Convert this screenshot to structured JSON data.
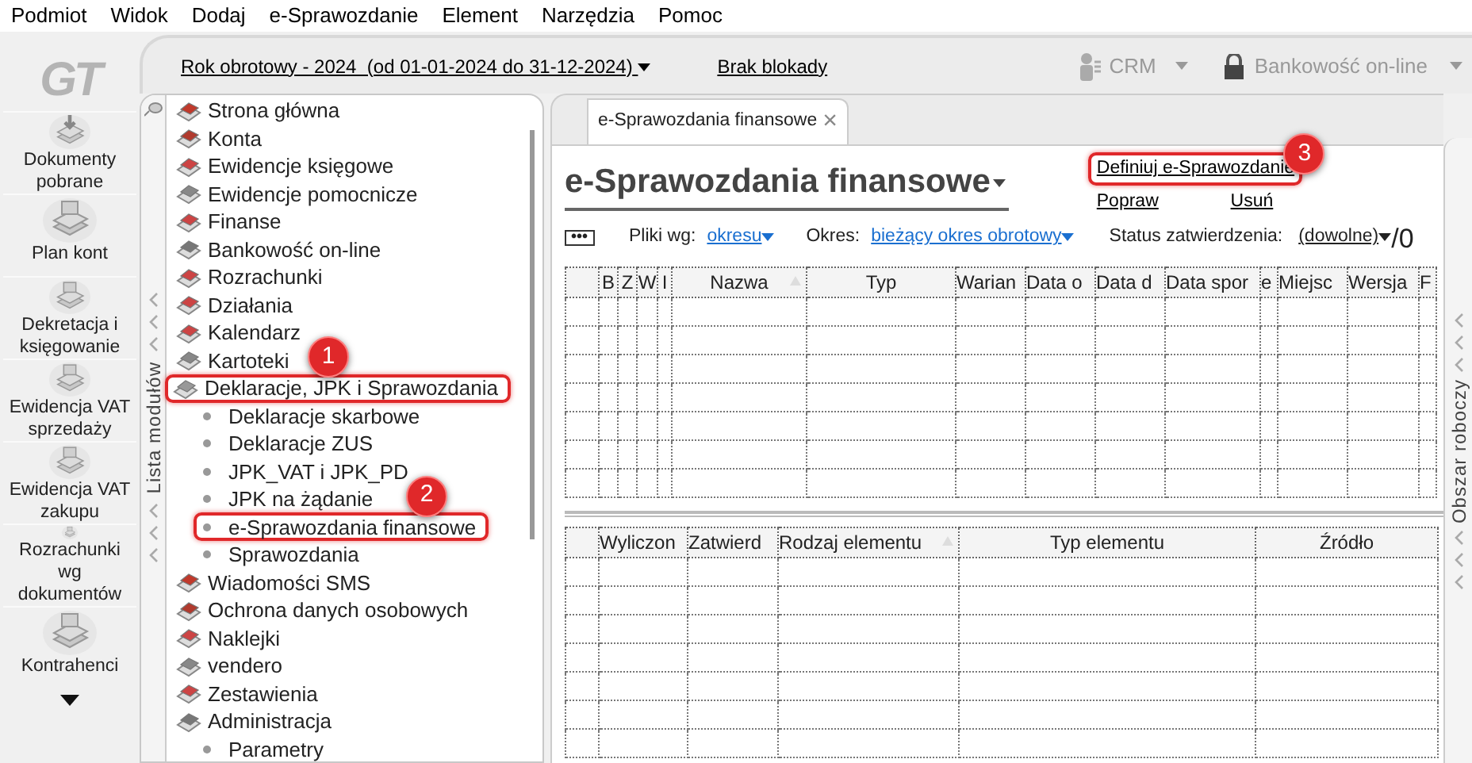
{
  "menu": [
    "Podmiot",
    "Widok",
    "Dodaj",
    "e-Sprawozdanie",
    "Element",
    "Narzędzia",
    "Pomoc"
  ],
  "logo": "GT",
  "toolbar": {
    "period": "Rok obrotowy - 2024  (od 01-01-2024 do 31-12-2024)",
    "lock": "Brak blokady",
    "crm": "CRM",
    "bank": "Bankowość on-line"
  },
  "nav": [
    {
      "label": "Dokumenty pobrane"
    },
    {
      "label": "Plan kont"
    },
    {
      "label": "Dekretacja i księgowanie"
    },
    {
      "label": "Ewidencja VAT sprzedaży"
    },
    {
      "label": "Ewidencja VAT zakupu"
    },
    {
      "label": "Rozrachunki wg dokumentów"
    },
    {
      "label": "Kontrahenci"
    }
  ],
  "modules": {
    "title": "Lista modułów",
    "items": [
      {
        "label": "Strona główna",
        "highlighted": false
      },
      {
        "label": "Konta",
        "highlighted": false
      },
      {
        "label": "Ewidencje księgowe",
        "highlighted": false
      },
      {
        "label": "Ewidencje pomocnicze",
        "highlighted": false
      },
      {
        "label": "Finanse",
        "highlighted": false
      },
      {
        "label": "Bankowość on-line",
        "highlighted": false
      },
      {
        "label": "Rozrachunki",
        "highlighted": false
      },
      {
        "label": "Działania",
        "highlighted": false
      },
      {
        "label": "Kalendarz",
        "highlighted": false
      },
      {
        "label": "Kartoteki",
        "highlighted": false
      },
      {
        "label": "Deklaracje, JPK i Sprawozdania",
        "highlighted": true,
        "callout": "1",
        "children": [
          {
            "label": "Deklaracje skarbowe",
            "highlighted": false
          },
          {
            "label": "Deklaracje ZUS",
            "highlighted": false
          },
          {
            "label": "JPK_VAT i JPK_PD",
            "highlighted": false
          },
          {
            "label": "JPK na żądanie",
            "highlighted": false
          },
          {
            "label": "e-Sprawozdania finansowe",
            "highlighted": true,
            "callout": "2"
          },
          {
            "label": "Sprawozdania",
            "highlighted": false
          }
        ]
      },
      {
        "label": "Wiadomości SMS",
        "highlighted": false
      },
      {
        "label": "Ochrona danych osobowych",
        "highlighted": false
      },
      {
        "label": "Naklejki",
        "highlighted": false
      },
      {
        "label": "vendero",
        "highlighted": false
      },
      {
        "label": "Zestawienia",
        "highlighted": false
      },
      {
        "label": "Administracja",
        "highlighted": false,
        "children": [
          {
            "label": "Parametry",
            "highlighted": false
          }
        ]
      }
    ]
  },
  "tab": {
    "label": "e-Sprawozdania finansowe",
    "close": "×"
  },
  "title": "e-Sprawozdania finansowe",
  "actions": [
    {
      "label": "Definiuj e-Sprawozdanie",
      "highlighted": true,
      "callout": "3"
    },
    {
      "label": "Popraw",
      "highlighted": false
    },
    {
      "label": "Usuń",
      "highlighted": false
    }
  ],
  "filters": {
    "more": "•••",
    "files_label": "Pliki wg:",
    "files_value": "okresu",
    "period_label": "Okres:",
    "period_value": "bieżący okres obrotowy",
    "status_label": "Status zatwierdzenia:",
    "status_value": "(dowolne)",
    "count": "/0"
  },
  "top_table": {
    "columns": [
      {
        "sorted": false
      },
      {
        "label": "B",
        "sorted": false
      },
      {
        "label": "Z",
        "sorted": false
      },
      {
        "label": "W",
        "sorted": false
      },
      {
        "label": "I",
        "sorted": false
      },
      {
        "label": "Nazwa",
        "sorted": true
      },
      {
        "label": "Typ",
        "sorted": false
      },
      {
        "label": "Warian",
        "sorted": false
      },
      {
        "label": "Data o",
        "sorted": false
      },
      {
        "label": "Data d",
        "sorted": false
      },
      {
        "label": "Data spor",
        "sorted": false
      },
      {
        "label": "e",
        "sorted": false
      },
      {
        "label": "Miejsc",
        "sorted": false
      },
      {
        "label": "Wersja",
        "sorted": false
      },
      {
        "label": "F",
        "sorted": false
      }
    ]
  },
  "bottom_table": {
    "columns": [
      {
        "sorted": false
      },
      {
        "label": "Wyliczon",
        "sorted": false
      },
      {
        "label": "Zatwierd",
        "sorted": false
      },
      {
        "label": "Rodzaj elementu",
        "sorted": true
      },
      {
        "label": "Typ elementu",
        "sorted": false
      },
      {
        "label": "Źródło",
        "sorted": false
      }
    ]
  },
  "right_panel": {
    "title": "Obszar roboczy"
  }
}
